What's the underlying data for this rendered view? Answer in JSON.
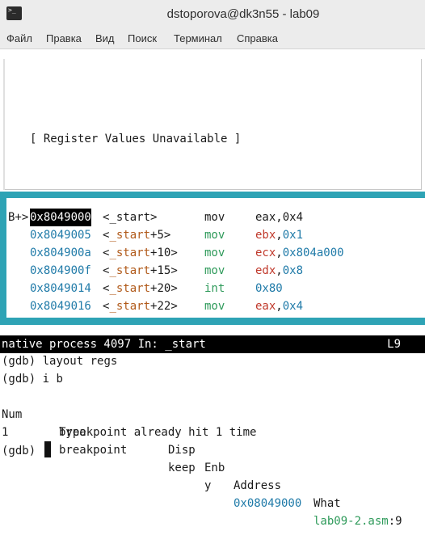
{
  "window": {
    "title": "dstoporova@dk3n55 - lab09",
    "app_icon_text": ">_"
  },
  "menu": {
    "items": [
      "Файл",
      "Правка",
      "Вид",
      "Поиск",
      "Терминал",
      "Справка"
    ]
  },
  "regs_panel": {
    "message": "[ Register Values Unavailable ]"
  },
  "asm_panel": {
    "breakpoint_marker": "B+>",
    "rows": [
      {
        "addr": "0x8049000",
        "sym_open": "<",
        "sym": "_start",
        "offset": "",
        "sym_close": ">",
        "op": "mov",
        "dst": "eax",
        "sep": ",",
        "src": "0x4"
      },
      {
        "addr": "0x8049005",
        "sym_open": "<",
        "sym": "_start",
        "offset": "+5",
        "sym_close": ">",
        "op": "mov",
        "dst": "ebx",
        "sep": ",",
        "src": "0x1"
      },
      {
        "addr": "0x804900a",
        "sym_open": "<",
        "sym": "_start",
        "offset": "+10",
        "sym_close": ">",
        "op": "mov",
        "dst": "ecx",
        "sep": ",",
        "src": "0x804a000"
      },
      {
        "addr": "0x804900f",
        "sym_open": "<",
        "sym": "_start",
        "offset": "+15",
        "sym_close": ">",
        "op": "mov",
        "dst": "edx",
        "sep": ",",
        "src": "0x8"
      },
      {
        "addr": "0x8049014",
        "sym_open": "<",
        "sym": "_start",
        "offset": "+20",
        "sym_close": ">",
        "op": "int",
        "dst": "",
        "sep": "",
        "src": "0x80"
      },
      {
        "addr": "0x8049016",
        "sym_open": "<",
        "sym": "_start",
        "offset": "+22",
        "sym_close": ">",
        "op": "mov",
        "dst": "eax",
        "sep": ",",
        "src": "0x4"
      }
    ]
  },
  "status": {
    "left": "native process 4097 In: _start",
    "right": "L9"
  },
  "console": {
    "prompt": "(gdb)",
    "cmd1": "layout regs",
    "cmd2": "i b",
    "header": {
      "num": "Num",
      "type": "Type",
      "disp": "Disp",
      "enb": "Enb",
      "address": "Address",
      "what": "What"
    },
    "bp_row": {
      "num": "1",
      "type": "breakpoint",
      "disp": "keep",
      "enb": "y",
      "address": "0x08049000",
      "file": "lab09-2.asm",
      "line_sep": ":",
      "line": "9"
    },
    "hit_note": "breakpoint already hit 1 time"
  }
}
